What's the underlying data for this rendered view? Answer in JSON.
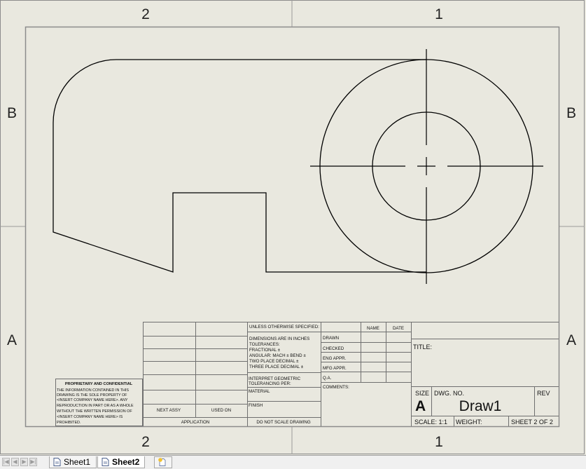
{
  "border": {
    "zone_columns": [
      "2",
      "1"
    ],
    "zone_rows": [
      "B",
      "A"
    ]
  },
  "title_block": {
    "unless_specified": "UNLESS OTHERWISE SPECIFIED:",
    "dimensions_in": "DIMENSIONS ARE IN INCHES",
    "tolerances": "TOLERANCES:",
    "fractional": "FRACTIONAL ±",
    "angular": "ANGULAR: MACH ±    BEND ±",
    "two_place": "TWO PLACE DECIMAL    ±",
    "three_place": "THREE PLACE DECIMAL  ±",
    "interpret_1": "INTERPRET GEOMETRIC",
    "interpret_2": "TOLERANCING PER:",
    "material": "MATERIAL",
    "finish": "FINISH",
    "do_not_scale": "DO NOT SCALE DRAWING",
    "next_assy": "NEXT ASSY",
    "used_on": "USED ON",
    "application": "APPLICATION",
    "name_header": "NAME",
    "date_header": "DATE",
    "drawn": "DRAWN",
    "checked": "CHECKED",
    "eng_appr": "ENG APPR.",
    "mfg_appr": "MFG APPR.",
    "qa": "Q.A.",
    "comments": "COMMENTS:",
    "title_label": "TITLE:",
    "size_label": "SIZE",
    "size_value": "A",
    "dwg_no_label": "DWG.  NO.",
    "dwg_no_value": "Draw1",
    "rev_label": "REV",
    "scale": "SCALE: 1:1",
    "weight": "WEIGHT:",
    "sheet_of": "SHEET 2 OF 2",
    "proprietary_title": "PROPRIETARY AND CONFIDENTIAL",
    "proprietary_lines": [
      "THE INFORMATION CONTAINED IN THIS",
      "DRAWING IS THE SOLE PROPERTY OF",
      "<INSERT COMPANY NAME HERE>.  ANY",
      "REPRODUCTION IN PART OR AS A WHOLE",
      "WITHOUT THE WRITTEN PERMISSION OF",
      "<INSERT COMPANY NAME HERE> IS",
      "PROHIBITED."
    ]
  },
  "tabs": [
    {
      "label": "Sheet1",
      "active": false
    },
    {
      "label": "Sheet2",
      "active": true
    }
  ],
  "icons": {
    "nav": [
      "first-sheet-icon",
      "prev-sheet-icon",
      "next-sheet-icon",
      "last-sheet-icon"
    ],
    "sheet": "sheet-icon",
    "add_sheet": "add-sheet-icon"
  },
  "colors": {
    "sheet_background": "#e9e8df",
    "line": "#000000",
    "frame": "#8c8c8c"
  }
}
